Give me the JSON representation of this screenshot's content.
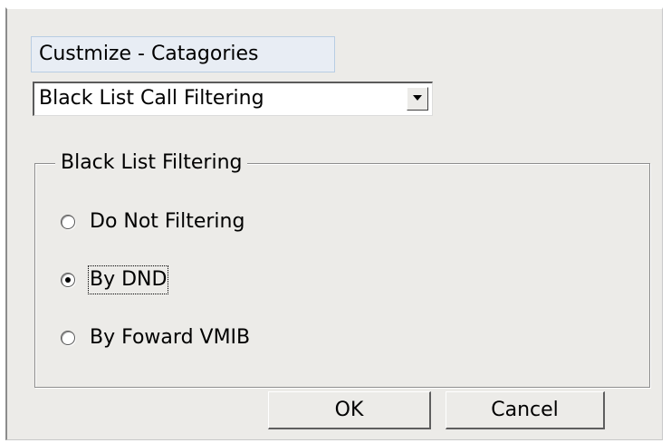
{
  "category": {
    "label": "Custmize - Catagories",
    "selected": "Black List Call Filtering"
  },
  "group": {
    "title": "Black List Filtering",
    "options": [
      {
        "label": "Do Not Filtering",
        "checked": false
      },
      {
        "label": "By DND",
        "checked": true
      },
      {
        "label": "By Foward VMIB",
        "checked": false
      }
    ]
  },
  "buttons": {
    "ok_label": "OK",
    "cancel_label": "Cancel"
  },
  "icons": {
    "combo_arrow": "chevron-down-icon"
  },
  "colors": {
    "dialog_bg": "#ecebe8",
    "label_bg": "#e8edf4",
    "label_border": "#b8cde3"
  }
}
